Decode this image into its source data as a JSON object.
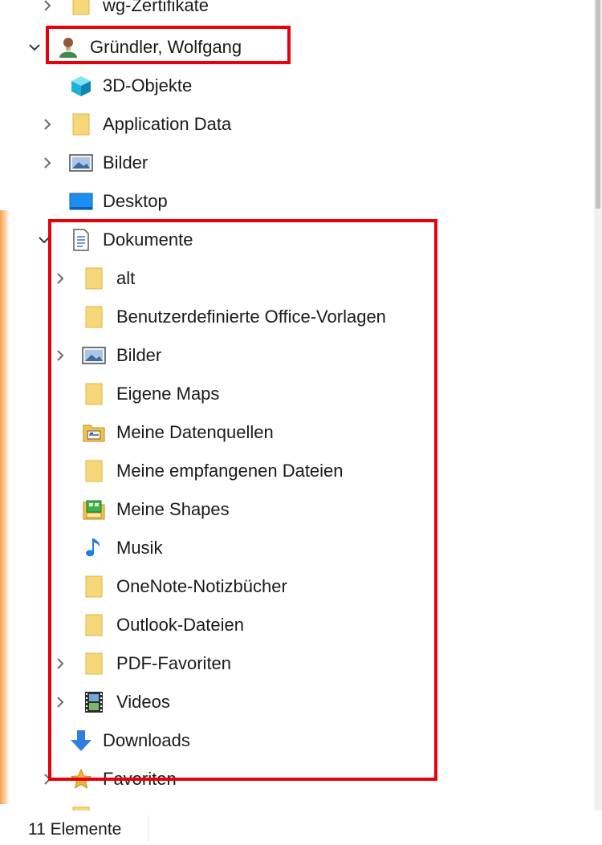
{
  "tree": {
    "cut_top": {
      "label": "wg-Zertifikate",
      "icon": "folder-icon"
    },
    "user": {
      "label": "Gründler, Wolfgang",
      "icon": "user-icon"
    },
    "items": [
      {
        "label": "3D-Objekte",
        "icon": "3d-objects-icon"
      },
      {
        "label": "Application Data",
        "icon": "folder-icon"
      },
      {
        "label": "Bilder",
        "icon": "pictures-icon"
      },
      {
        "label": "Desktop",
        "icon": "desktop-icon"
      },
      {
        "label": "Dokumente",
        "icon": "documents-icon"
      }
    ],
    "documents_children": [
      {
        "label": "alt",
        "icon": "folder-icon"
      },
      {
        "label": "Benutzerdefinierte Office-Vorlagen",
        "icon": "folder-icon"
      },
      {
        "label": "Bilder",
        "icon": "pictures-icon"
      },
      {
        "label": "Eigene Maps",
        "icon": "folder-icon"
      },
      {
        "label": "Meine Datenquellen",
        "icon": "data-sources-folder-icon"
      },
      {
        "label": "Meine empfangenen Dateien",
        "icon": "folder-icon"
      },
      {
        "label": "Meine Shapes",
        "icon": "shapes-folder-icon"
      },
      {
        "label": "Musik",
        "icon": "music-note-icon"
      },
      {
        "label": "OneNote-Notizbücher",
        "icon": "folder-icon"
      },
      {
        "label": "Outlook-Dateien",
        "icon": "folder-icon"
      },
      {
        "label": "PDF-Favoriten",
        "icon": "folder-icon"
      },
      {
        "label": "Videos",
        "icon": "videos-icon"
      }
    ],
    "after": [
      {
        "label": "Downloads",
        "icon": "download-arrow-icon"
      },
      {
        "label": "Favoriten",
        "icon": "star-icon"
      }
    ]
  },
  "status": {
    "count": "11 Elemente"
  },
  "colors": {
    "highlight": "#e8000b",
    "folder": "#f6d87a",
    "accent": "#f5a24c"
  }
}
